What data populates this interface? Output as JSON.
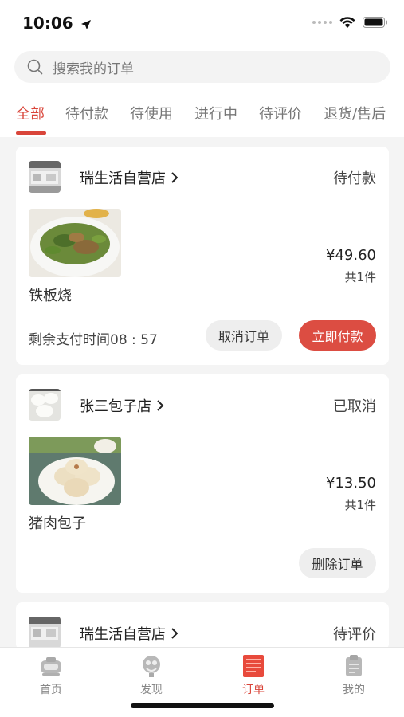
{
  "status_bar": {
    "time": "10:06"
  },
  "search": {
    "placeholder": "搜索我的订单"
  },
  "tabs": [
    {
      "label": "全部",
      "active": true
    },
    {
      "label": "待付款"
    },
    {
      "label": "待使用"
    },
    {
      "label": "进行中"
    },
    {
      "label": "待评价"
    },
    {
      "label": "退货/售后"
    }
  ],
  "orders": [
    {
      "store": "瑞生活自营店",
      "status": "待付款",
      "item": "铁板烧",
      "price": "¥49.60",
      "qty": "共1件",
      "timer": "剩余支付时间08 : 57",
      "buttons": {
        "cancel": "取消订单",
        "pay": "立即付款"
      }
    },
    {
      "store": "张三包子店",
      "status": "已取消",
      "item": "猪肉包子",
      "price": "¥13.50",
      "qty": "共1件",
      "buttons": {
        "delete": "删除订单"
      }
    },
    {
      "store": "瑞生活自营店",
      "status": "待评价"
    }
  ],
  "bottom_nav": [
    {
      "label": "首页",
      "icon": "home-icon"
    },
    {
      "label": "发现",
      "icon": "discover-icon"
    },
    {
      "label": "订单",
      "icon": "orders-icon",
      "active": true
    },
    {
      "label": "我的",
      "icon": "profile-icon"
    }
  ],
  "colors": {
    "accent": "#d9453a",
    "pay_button": "#dc4d42"
  }
}
